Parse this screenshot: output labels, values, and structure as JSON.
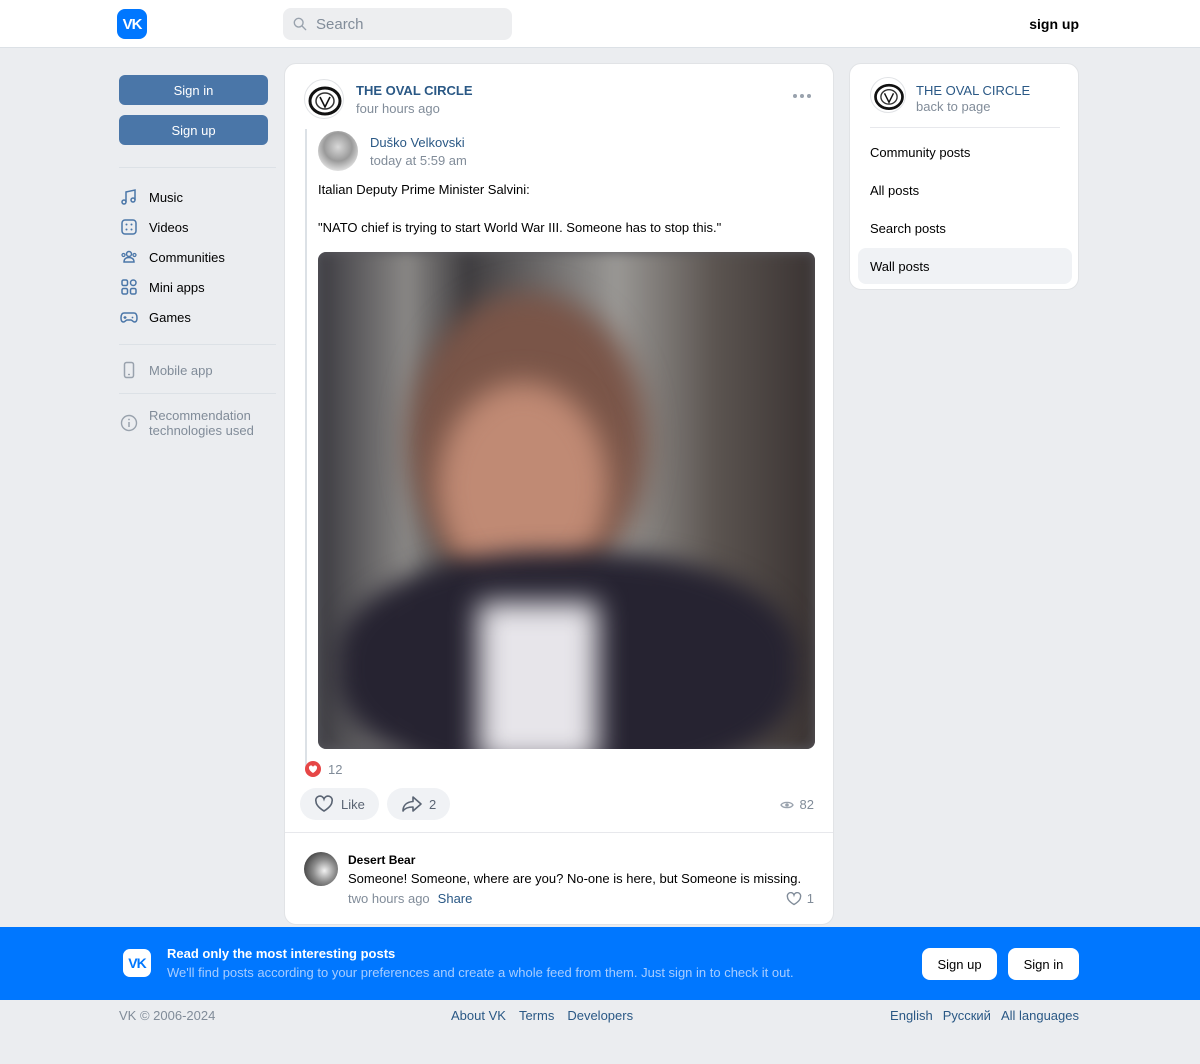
{
  "header": {
    "logo_text": "VK",
    "search_placeholder": "Search",
    "signup_label": "sign up"
  },
  "sidebar": {
    "sign_in_label": "Sign in",
    "sign_up_label": "Sign up",
    "nav": [
      {
        "label": "Music",
        "icon": "music-icon"
      },
      {
        "label": "Videos",
        "icon": "video-icon"
      },
      {
        "label": "Communities",
        "icon": "communities-icon"
      },
      {
        "label": "Mini apps",
        "icon": "mini-apps-icon"
      },
      {
        "label": "Games",
        "icon": "gamepad-icon"
      }
    ],
    "mobile_app_label": "Mobile app",
    "recommendation_line1": "Recommendation",
    "recommendation_line2": "technologies used"
  },
  "post": {
    "group_name": "THE OVAL CIRCLE",
    "time": "four hours ago",
    "repost": {
      "author": "Duško Velkovski",
      "time": "today at 5:59 am",
      "text_line1": "Italian Deputy Prime Minister Salvini:",
      "text_line2": "\"NATO chief is trying to start World War III. Someone has to stop this.\""
    },
    "reactions_count": "12",
    "like_label": "Like",
    "share_count": "2",
    "views_count": "82",
    "comment": {
      "author": "Desert Bear",
      "text": "Someone! Someone, where are you? No-one is here, but Someone is missing.",
      "time": "two hours ago",
      "share_label": "Share",
      "likes": "1"
    }
  },
  "right_panel": {
    "group_name": "THE OVAL CIRCLE",
    "back_label": "back to page",
    "links": [
      "Community posts",
      "All posts",
      "Search posts",
      "Wall posts"
    ],
    "active_link": "Wall posts"
  },
  "banner": {
    "logo_text": "VK",
    "title": "Read only the most interesting posts",
    "subtitle": "We'll find posts according to your preferences and create a whole feed from them. Just sign in to check it out.",
    "sign_up_label": "Sign up",
    "sign_in_label": "Sign in"
  },
  "footer": {
    "copyright": "VK © 2006-2024",
    "links": [
      "About VK",
      "Terms",
      "Developers"
    ],
    "languages": [
      "English",
      "Русский",
      "All languages"
    ]
  },
  "colors": {
    "brand": "#0077ff",
    "link": "#2a5885",
    "button": "#4a76a8",
    "muted": "#818c99",
    "background": "#ebedf0",
    "reaction": "#e64646"
  }
}
